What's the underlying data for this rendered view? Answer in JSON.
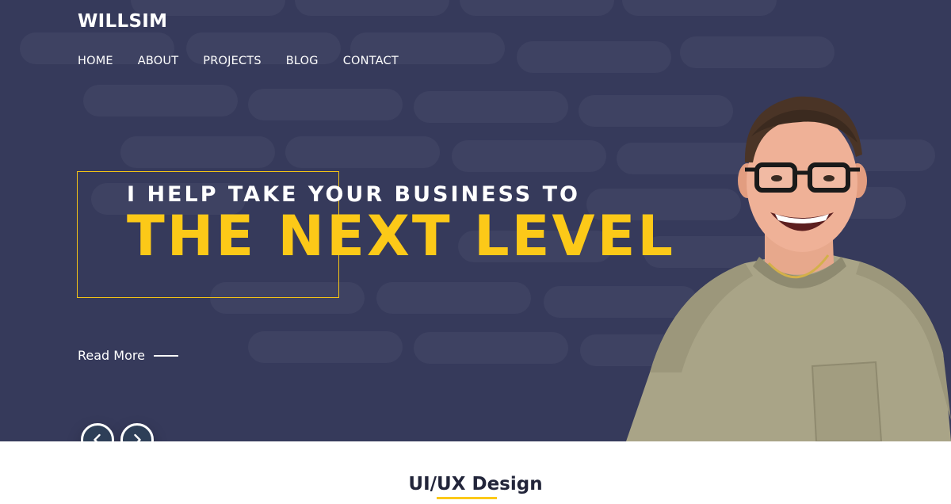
{
  "brand": {
    "logo": "WILLSIM"
  },
  "nav": {
    "items": [
      "HOME",
      "ABOUT",
      "PROJECTS",
      "BLOG",
      "CONTACT"
    ]
  },
  "hero": {
    "tagline": "I HELP TAKE YOUR BUSINESS TO",
    "headline": "THE NEXT LEVEL",
    "read_more": "Read More"
  },
  "slider": {
    "prev_icon": "chevron-left-icon",
    "next_icon": "chevron-right-icon"
  },
  "service": {
    "title": "UI/UX Design"
  },
  "colors": {
    "hero_bg": "#363a5b",
    "accent": "#fcc918",
    "text_light": "#ffffff",
    "button_bg": "#2e3f58"
  }
}
